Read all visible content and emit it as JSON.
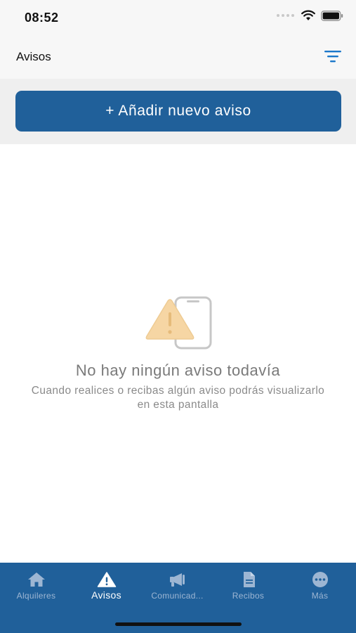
{
  "status_bar": {
    "time": "08:52"
  },
  "header": {
    "title": "Avisos",
    "filter_icon": "filter-icon"
  },
  "actions": {
    "add_label": "+ Añadir nuevo aviso"
  },
  "empty_state": {
    "icon": "warning-phone-illustration",
    "title": "No hay ningún aviso todavía",
    "description": "Cuando realices o recibas algún aviso podrás visualizarlo en esta pantalla"
  },
  "tabs": [
    {
      "label": "Alquileres",
      "icon": "home-icon",
      "active": false
    },
    {
      "label": "Avisos",
      "icon": "warning-icon",
      "active": true
    },
    {
      "label": "Comunicad...",
      "icon": "megaphone-icon",
      "active": false
    },
    {
      "label": "Recibos",
      "icon": "document-icon",
      "active": false
    },
    {
      "label": "Más",
      "icon": "more-icon",
      "active": false
    }
  ],
  "colors": {
    "primary": "#20609a",
    "accent": "#1a77c9",
    "warning": "#f6d6a4",
    "tab_inactive": "#9db6d3"
  }
}
